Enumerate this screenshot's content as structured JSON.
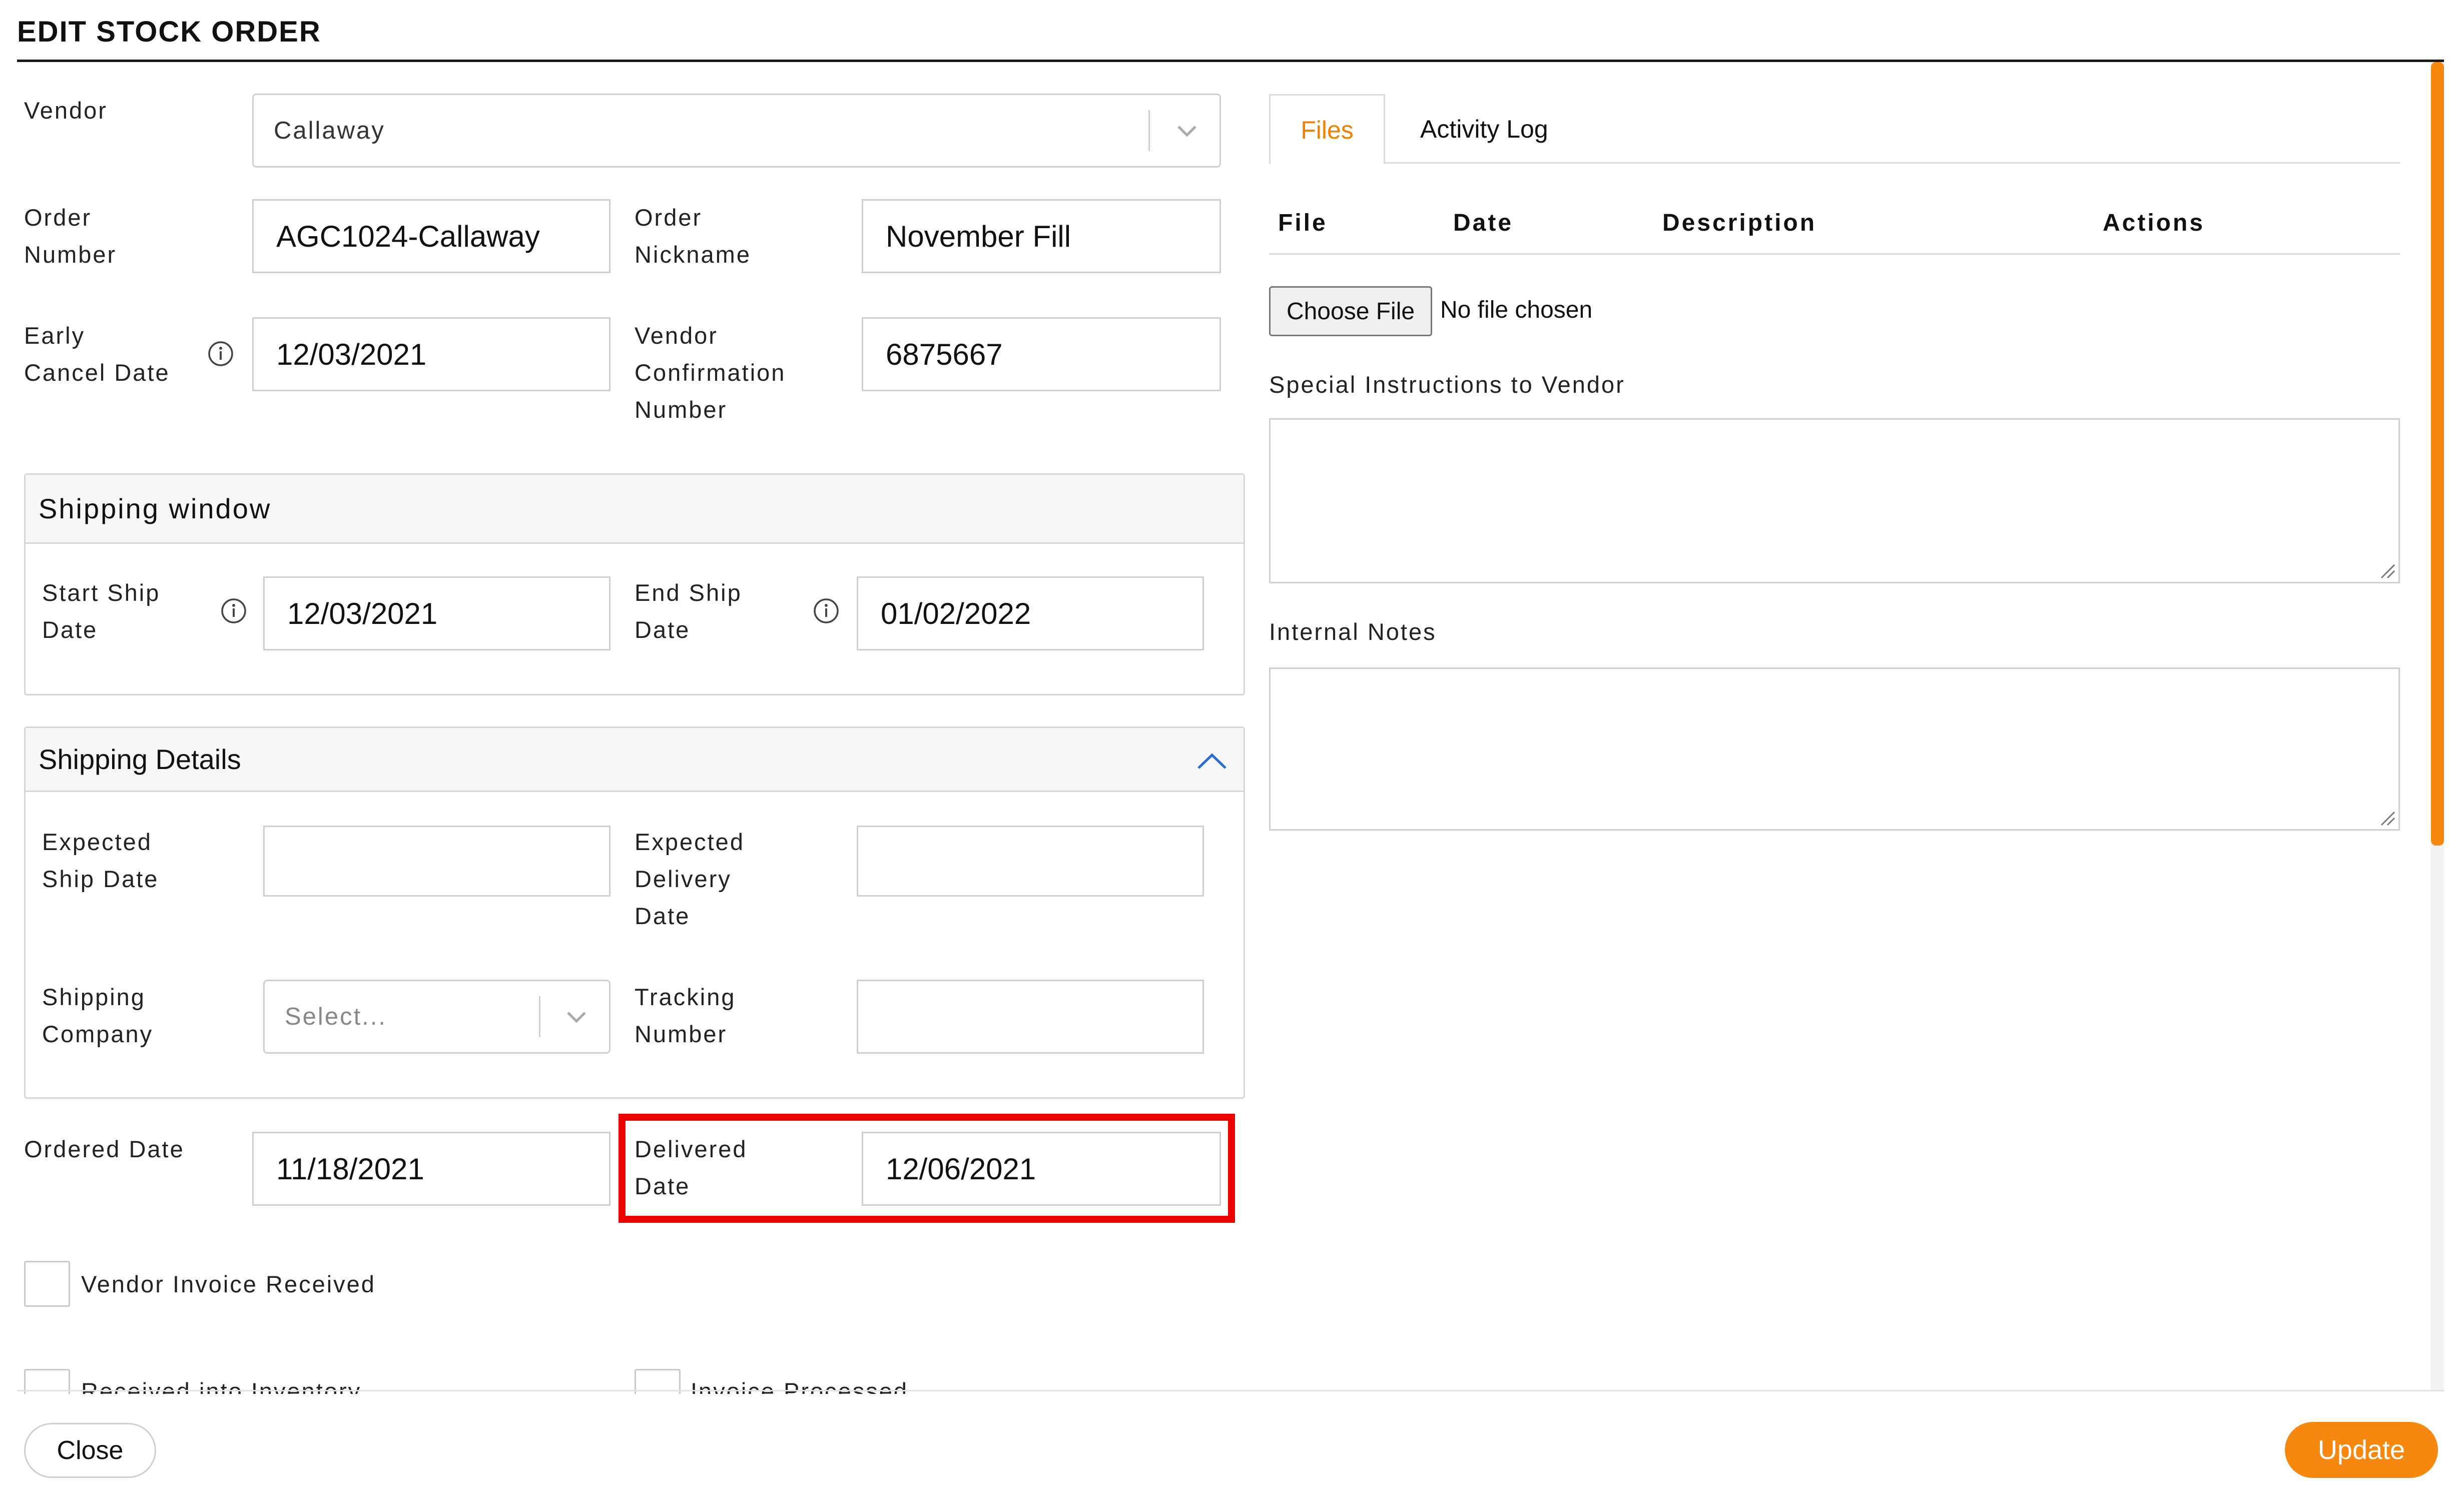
{
  "title": "EDIT STOCK ORDER",
  "form": {
    "vendor_label": "Vendor",
    "vendor_value": "Callaway",
    "order_number_label_1": "Order",
    "order_number_label_2": "Number",
    "order_number_value": "AGC1024-Callaway",
    "order_nickname_label_1": "Order",
    "order_nickname_label_2": "Nickname",
    "order_nickname_value": "November Fill",
    "early_cancel_label_1": "Early",
    "early_cancel_label_2": "Cancel Date",
    "early_cancel_value": "12/03/2021",
    "vendor_conf_label_1": "Vendor",
    "vendor_conf_label_2": "Confirmation",
    "vendor_conf_label_3": "Number",
    "vendor_conf_value": "6875667"
  },
  "shipping_window": {
    "title": "Shipping window",
    "start_label_1": "Start Ship",
    "start_label_2": "Date",
    "start_value": "12/03/2021",
    "end_label_1": "End Ship",
    "end_label_2": "Date",
    "end_value": "01/02/2022"
  },
  "shipping_details": {
    "title": "Shipping Details",
    "exp_ship_label_1": "Expected",
    "exp_ship_label_2": "Ship Date",
    "exp_ship_value": "",
    "exp_delivery_label_1": "Expected",
    "exp_delivery_label_2": "Delivery",
    "exp_delivery_label_3": "Date",
    "exp_delivery_value": "",
    "company_label_1": "Shipping",
    "company_label_2": "Company",
    "company_placeholder": "Select...",
    "tracking_label_1": "Tracking",
    "tracking_label_2": "Number",
    "tracking_value": ""
  },
  "dates": {
    "ordered_label": "Ordered Date",
    "ordered_value": "11/18/2021",
    "delivered_label_1": "Delivered",
    "delivered_label_2": "Date",
    "delivered_value": "12/06/2021"
  },
  "checkboxes": {
    "vendor_invoice": "Vendor Invoice Received",
    "received_inventory": "Received into Inventory",
    "invoice_processed": "Invoice Processed"
  },
  "right_panel": {
    "tabs": [
      "Files",
      "Activity Log"
    ],
    "columns": [
      "File",
      "Date",
      "Description",
      "Actions"
    ],
    "choose_file": "Choose File",
    "no_file": "No file chosen",
    "special_instructions_label": "Special Instructions to Vendor",
    "internal_notes_label": "Internal Notes"
  },
  "footer": {
    "close": "Close",
    "update": "Update"
  },
  "colors": {
    "accent": "#f6870f",
    "highlight": "#ee0000",
    "chevron_blue": "#2a6ad8"
  },
  "icons": [
    "chevron-down-icon",
    "info-icon",
    "chevron-up-icon",
    "resize-handle-icon"
  ]
}
